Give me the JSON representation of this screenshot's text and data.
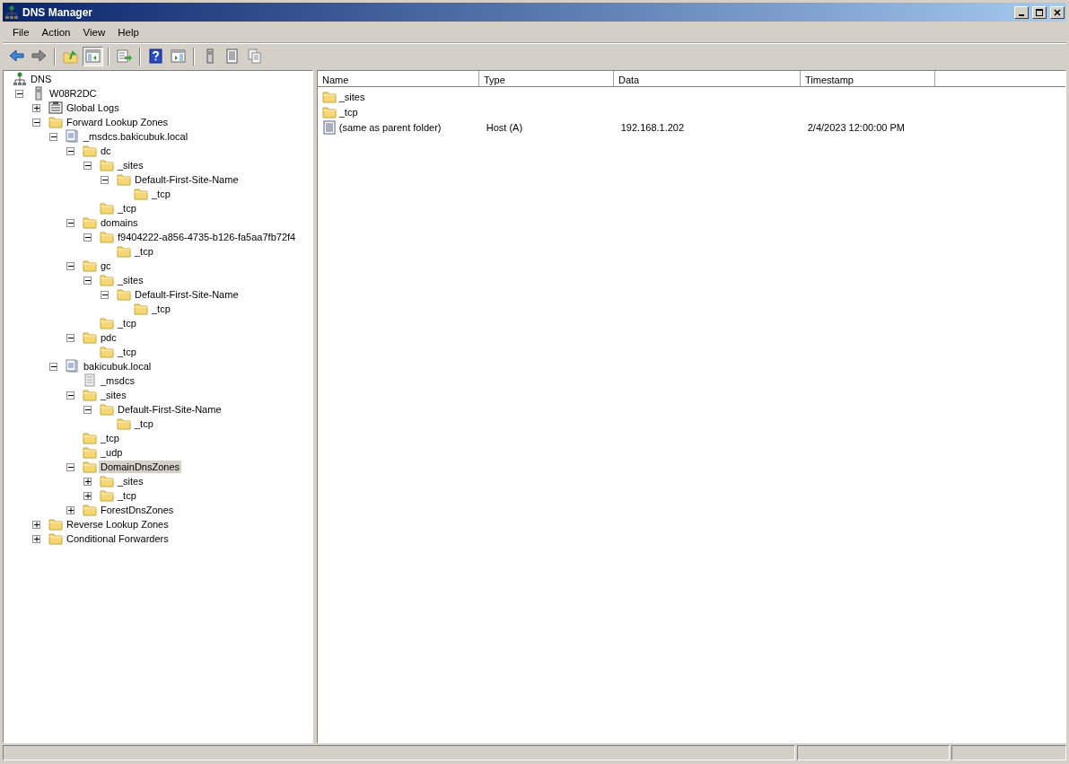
{
  "window": {
    "title": "DNS Manager",
    "controls": [
      {
        "kind": "minimize"
      },
      {
        "kind": "maximize"
      },
      {
        "kind": "close"
      }
    ]
  },
  "menu": [
    "File",
    "Action",
    "View",
    "Help"
  ],
  "toolbar": [
    {
      "kind": "back",
      "pressed": false
    },
    {
      "kind": "forward",
      "pressed": false
    },
    {
      "kind": "sep"
    },
    {
      "kind": "up",
      "pressed": false
    },
    {
      "kind": "tree",
      "pressed": true
    },
    {
      "kind": "sep"
    },
    {
      "kind": "export",
      "pressed": false
    },
    {
      "kind": "sep"
    },
    {
      "kind": "help",
      "pressed": false
    },
    {
      "kind": "console",
      "pressed": false
    },
    {
      "kind": "sep"
    },
    {
      "kind": "server",
      "pressed": false
    },
    {
      "kind": "list",
      "pressed": false
    },
    {
      "kind": "pages",
      "pressed": false
    }
  ],
  "tree": [
    {
      "label": "DNS",
      "kind": "dns",
      "selected": false,
      "children": [
        {
          "label": "W08R2DC",
          "kind": "server",
          "expanded": true,
          "selected": false,
          "children": [
            {
              "label": "Global Logs",
              "kind": "logs",
              "expanded": false,
              "selected": false
            },
            {
              "label": "Forward Lookup Zones",
              "kind": "folder",
              "expanded": true,
              "selected": false,
              "children": [
                {
                  "label": "_msdcs.bakicubuk.local",
                  "kind": "zone",
                  "expanded": true,
                  "selected": false,
                  "children": [
                    {
                      "label": "dc",
                      "kind": "folder",
                      "expanded": true,
                      "selected": false,
                      "children": [
                        {
                          "label": "_sites",
                          "kind": "folder",
                          "expanded": true,
                          "selected": false,
                          "children": [
                            {
                              "label": "Default-First-Site-Name",
                              "kind": "folder",
                              "expanded": true,
                              "selected": false,
                              "children": [
                                {
                                  "label": "_tcp",
                                  "kind": "folder",
                                  "selected": false
                                }
                              ]
                            }
                          ]
                        },
                        {
                          "label": "_tcp",
                          "kind": "folder",
                          "selected": false
                        }
                      ]
                    },
                    {
                      "label": "domains",
                      "kind": "folder",
                      "expanded": true,
                      "selected": false,
                      "children": [
                        {
                          "label": "f9404222-a856-4735-b126-fa5aa7fb72f4",
                          "kind": "folder",
                          "expanded": true,
                          "selected": false,
                          "children": [
                            {
                              "label": "_tcp",
                              "kind": "folder",
                              "selected": false
                            }
                          ]
                        }
                      ]
                    },
                    {
                      "label": "gc",
                      "kind": "folder",
                      "expanded": true,
                      "selected": false,
                      "children": [
                        {
                          "label": "_sites",
                          "kind": "folder",
                          "expanded": true,
                          "selected": false,
                          "children": [
                            {
                              "label": "Default-First-Site-Name",
                              "kind": "folder",
                              "expanded": true,
                              "selected": false,
                              "children": [
                                {
                                  "label": "_tcp",
                                  "kind": "folder",
                                  "selected": false
                                }
                              ]
                            }
                          ]
                        },
                        {
                          "label": "_tcp",
                          "kind": "folder",
                          "selected": false
                        }
                      ]
                    },
                    {
                      "label": "pdc",
                      "kind": "folder",
                      "expanded": true,
                      "selected": false,
                      "children": [
                        {
                          "label": "_tcp",
                          "kind": "folder",
                          "selected": false
                        }
                      ]
                    }
                  ]
                },
                {
                  "label": "bakicubuk.local",
                  "kind": "zone",
                  "expanded": true,
                  "selected": false,
                  "children": [
                    {
                      "label": "_msdcs",
                      "kind": "delegation",
                      "selected": false
                    },
                    {
                      "label": "_sites",
                      "kind": "folder",
                      "expanded": true,
                      "selected": false,
                      "children": [
                        {
                          "label": "Default-First-Site-Name",
                          "kind": "folder",
                          "expanded": true,
                          "selected": false,
                          "children": [
                            {
                              "label": "_tcp",
                              "kind": "folder",
                              "selected": false
                            }
                          ]
                        }
                      ]
                    },
                    {
                      "label": "_tcp",
                      "kind": "folder",
                      "selected": false
                    },
                    {
                      "label": "_udp",
                      "kind": "folder",
                      "selected": false
                    },
                    {
                      "label": "DomainDnsZones",
                      "kind": "folder",
                      "expanded": true,
                      "selected": true,
                      "children": [
                        {
                          "label": "_sites",
                          "kind": "folder",
                          "expanded": false,
                          "selected": false
                        },
                        {
                          "label": "_tcp",
                          "kind": "folder",
                          "expanded": false,
                          "selected": false
                        }
                      ]
                    },
                    {
                      "label": "ForestDnsZones",
                      "kind": "folder",
                      "expanded": false,
                      "selected": false
                    }
                  ]
                }
              ]
            },
            {
              "label": "Reverse Lookup Zones",
              "kind": "folder",
              "expanded": false,
              "selected": false
            },
            {
              "label": "Conditional Forwarders",
              "kind": "folder",
              "expanded": false,
              "selected": false
            }
          ]
        }
      ]
    }
  ],
  "list": {
    "columns": [
      "Name",
      "Type",
      "Data",
      "Timestamp"
    ],
    "rows": [
      {
        "kind": "folder",
        "cells": [
          "_sites"
        ]
      },
      {
        "kind": "folder",
        "cells": [
          "_tcp"
        ]
      },
      {
        "kind": "record",
        "cells": [
          "(same as parent folder)",
          "Host (A)",
          "192.168.1.202",
          "2/4/2023 12:00:00 PM"
        ]
      }
    ]
  }
}
